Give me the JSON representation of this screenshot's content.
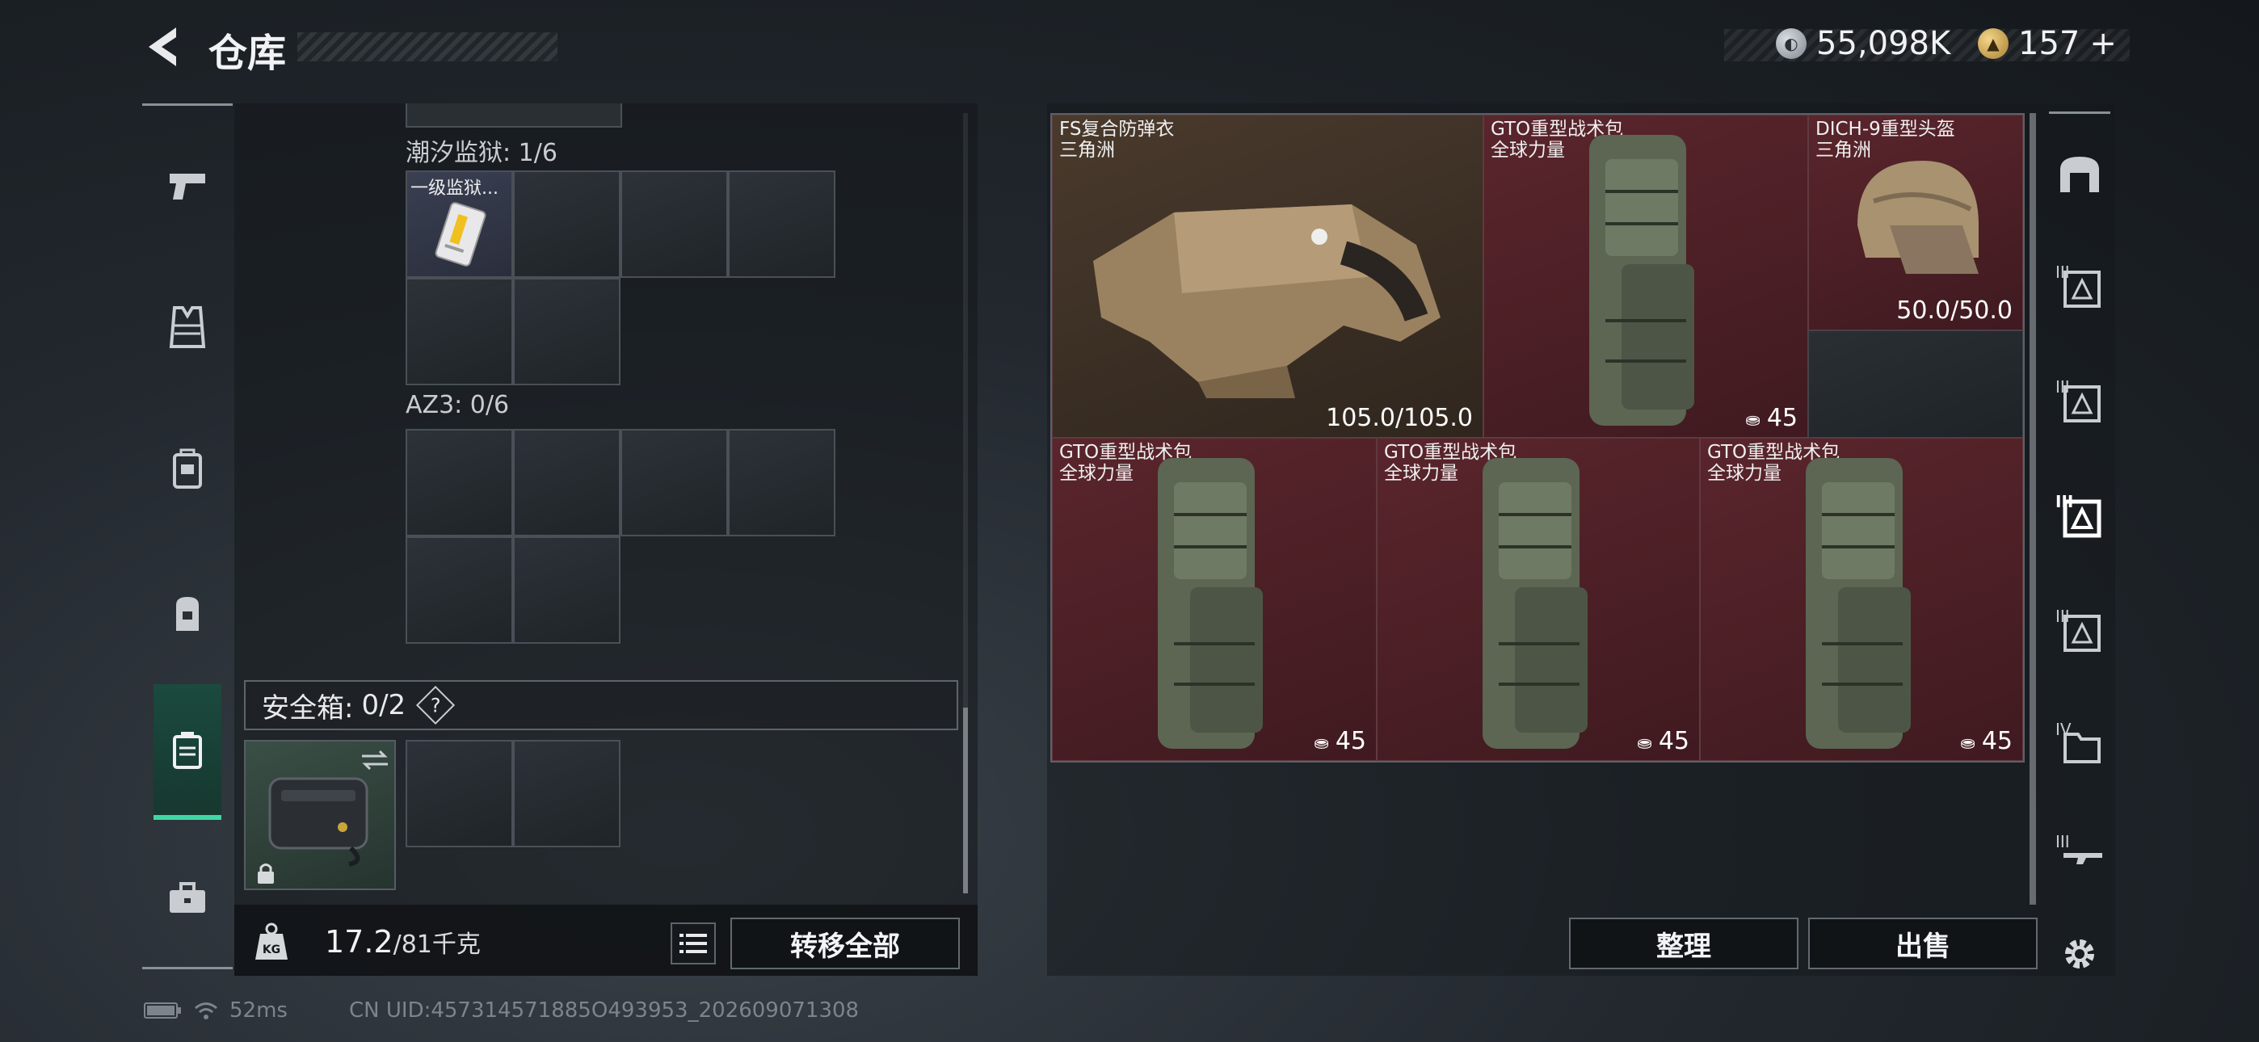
{
  "header": {
    "title": "仓库",
    "currency_1": "55,098K",
    "currency_2": "157",
    "currency_2_plus": "+"
  },
  "left_nav": {
    "icons": [
      "pistol-icon",
      "vest-icon",
      "chest-rig-icon",
      "backpack-icon",
      "safebox-icon",
      "toolbox-icon"
    ],
    "active_index": 4
  },
  "left": {
    "section_1_label": "潮汐监狱: 1/6",
    "section_1_item_name": "一级监狱...",
    "section_2_label": "AZ3: 0/6",
    "safebox_label": "安全箱:",
    "safebox_count": "0/2",
    "safebox_help": "?",
    "weight_current": "17.2",
    "weight_max": "/81千克",
    "weight_icon_text": "KG",
    "transfer_all": "转移全部"
  },
  "right": {
    "items": [
      {
        "name": "FS复合防弹衣",
        "sub": "三角洲",
        "value": "105.0/105.0",
        "type": "armor"
      },
      {
        "name": "GTO重型战术包",
        "sub": "全球力量",
        "value": "45",
        "type": "backpack"
      },
      {
        "name": "DICH-9重型头盔",
        "sub": "三角洲",
        "value": "50.0/50.0",
        "type": "helmet"
      },
      {
        "name": "GTO重型战术包",
        "sub": "全球力量",
        "value": "45",
        "type": "backpack"
      },
      {
        "name": "GTO重型战术包",
        "sub": "全球力量",
        "value": "45",
        "type": "backpack"
      },
      {
        "name": "GTO重型战术包",
        "sub": "全球力量",
        "value": "45",
        "type": "backpack"
      }
    ],
    "sort_button": "整理",
    "sell_button": "出售"
  },
  "right_nav": {
    "tier_labels": [
      "III",
      "III",
      "III",
      "III",
      "IV",
      "III"
    ]
  },
  "footer": {
    "ping": "52ms",
    "uid": "CN UID:457314571885O493953_202609071308"
  },
  "colors": {
    "accent": "#3fd6a4",
    "item_red": "#5a252c",
    "item_brown": "#4a3a2c"
  }
}
